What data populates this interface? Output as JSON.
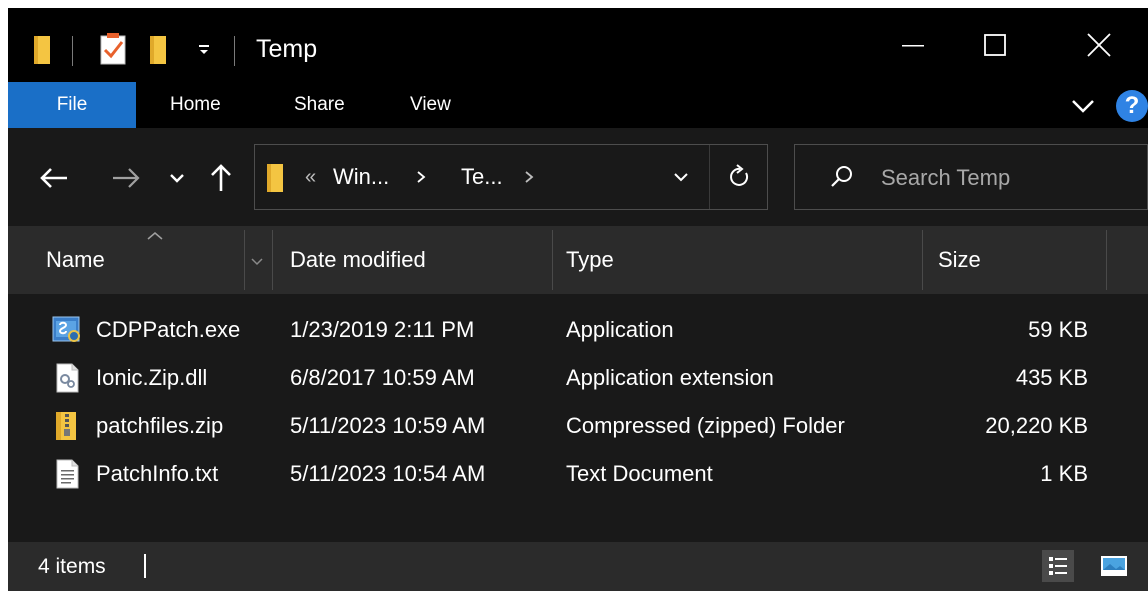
{
  "window": {
    "title": "Temp"
  },
  "ribbon": {
    "tabs": [
      "File",
      "Home",
      "Share",
      "View"
    ],
    "help": "?"
  },
  "address": {
    "overflow": "«",
    "crumbs": [
      "Win...",
      "Te..."
    ]
  },
  "search": {
    "placeholder": "Search Temp"
  },
  "columns": {
    "name": "Name",
    "date": "Date modified",
    "type": "Type",
    "size": "Size"
  },
  "files": [
    {
      "name": "CDPPatch.exe",
      "date": "1/23/2019 2:11 PM",
      "type": "Application",
      "size": "59 KB",
      "icon": "application-icon"
    },
    {
      "name": "Ionic.Zip.dll",
      "date": "6/8/2017 10:59 AM",
      "type": "Application extension",
      "size": "435 KB",
      "icon": "dll-file-icon"
    },
    {
      "name": "patchfiles.zip",
      "date": "5/11/2023 10:59 AM",
      "type": "Compressed (zipped) Folder",
      "size": "20,220 KB",
      "icon": "zip-folder-icon"
    },
    {
      "name": "PatchInfo.txt",
      "date": "5/11/2023 10:54 AM",
      "type": "Text Document",
      "size": "1 KB",
      "icon": "text-document-icon"
    }
  ],
  "status": {
    "items": "4 items"
  },
  "colors": {
    "window_bg": "#191919",
    "titlebar_bg": "#000000",
    "file_tab": "#1a6fc7",
    "header_bg": "#2b2b2b",
    "folder_yellow": "#f4c542"
  }
}
